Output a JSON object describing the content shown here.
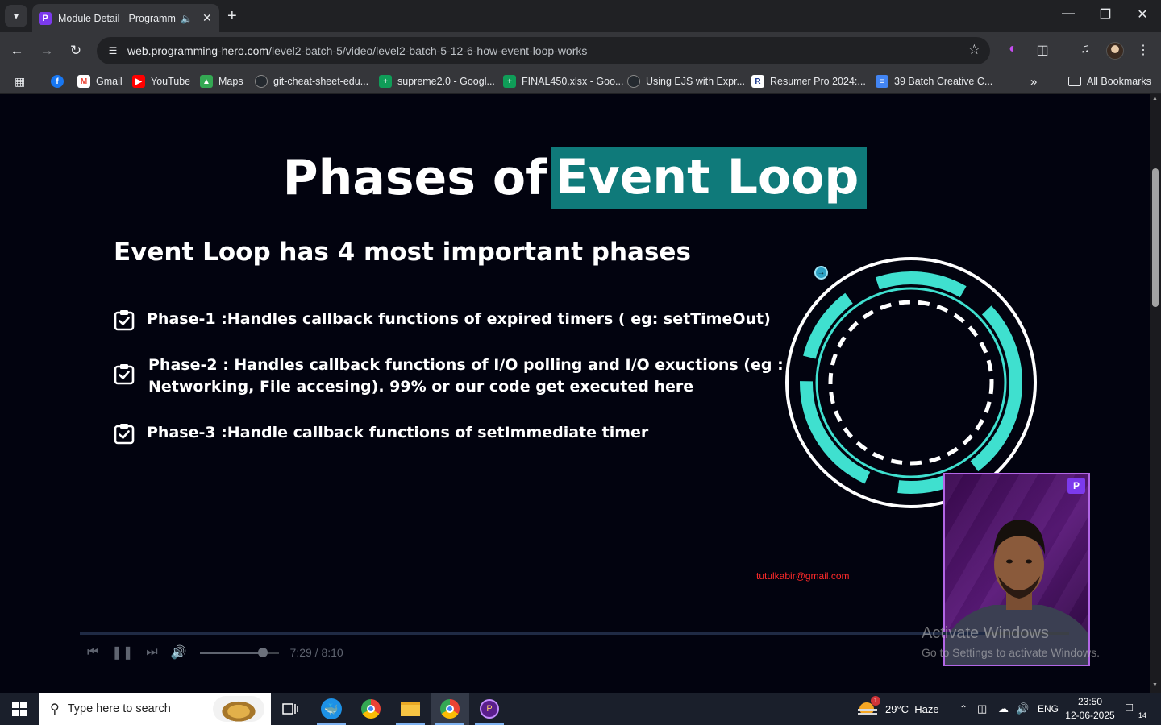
{
  "browser": {
    "tab": {
      "title": "Module Detail - Programmi",
      "favicon": "programming-hero-icon"
    },
    "address": {
      "domain": "web.programming-hero.com",
      "path": "/level2-batch-5/video/level2-batch-5-12-6-how-event-loop-works"
    },
    "bookmarks": [
      {
        "label": "",
        "icon": "facebook-icon",
        "color": "#1877f2"
      },
      {
        "label": "Gmail",
        "icon": "gmail-icon",
        "color": "#ea4335"
      },
      {
        "label": "YouTube",
        "icon": "youtube-icon",
        "color": "#ff0000"
      },
      {
        "label": "Maps",
        "icon": "maps-icon",
        "color": "#34a853"
      },
      {
        "label": "git-cheat-sheet-edu...",
        "icon": "github-icon",
        "color": "#24292f"
      },
      {
        "label": "supreme2.0 - Googl...",
        "icon": "sheets-icon",
        "color": "#0f9d58"
      },
      {
        "label": "FINAL450.xlsx - Goo...",
        "icon": "sheets-icon",
        "color": "#0f9d58"
      },
      {
        "label": "Using EJS with Expr...",
        "icon": "github-icon",
        "color": "#24292f"
      },
      {
        "label": "Resumer Pro 2024:...",
        "icon": "resumer-icon",
        "color": "#ffffff"
      },
      {
        "label": "39 Batch Creative C...",
        "icon": "docs-icon",
        "color": "#4285f4"
      }
    ],
    "all_bookmarks": "All Bookmarks"
  },
  "slide": {
    "title_plain": "Phases of",
    "title_highlight": "Event Loop",
    "subtitle": "Event Loop has 4 most important phases",
    "phases": [
      {
        "lines": [
          "Phase-1 :Handles callback functions of expired timers ( eg: setTimeOut)"
        ]
      },
      {
        "lines": [
          "Phase-2 : Handles callback functions of I/O polling and I/O exuctions (eg :",
          "Networking, File accesing). 99% or our code get executed here"
        ]
      },
      {
        "lines": [
          "Phase-3 :Handle callback functions of setImmediate timer"
        ]
      }
    ],
    "highlight_color": "#0f7a7a",
    "ring_color": "#3fe0cf"
  },
  "watermark_email": "tutulkabir@gmail.com",
  "player": {
    "time": "7:29 / 8:10",
    "progress_fraction": 0.915,
    "volume_fraction": 0.8
  },
  "activate_windows": {
    "line1": "Activate Windows",
    "line2": "Go to Settings to activate Windows."
  },
  "taskbar": {
    "search_placeholder": "Type here to search",
    "weather": "29°C  Haze",
    "weather_badge": "1",
    "language": "ENG",
    "time": "23:50",
    "date": "12-06-2025",
    "notification_count": "14"
  }
}
